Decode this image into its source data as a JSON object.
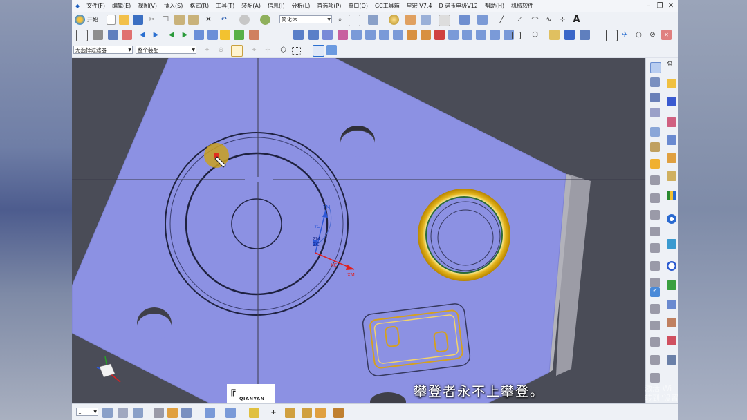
{
  "menu": {
    "items": [
      "文件(F)",
      "编辑(E)",
      "视图(V)",
      "插入(S)",
      "格式(R)",
      "工具(T)",
      "装配(A)",
      "信息(I)",
      "分析(L)",
      "首选项(P)",
      "窗口(O)",
      "GC工具箱",
      "星宏 V7.4",
      "D 诺玉电极V12",
      "帮助(H)",
      "机械软件"
    ]
  },
  "toolbar": {
    "start_label": "开始",
    "shape_dropdown": "简化体",
    "filter_dropdown": "无选择过滤器",
    "scope_dropdown": "整个装配",
    "status_dropdown": "1"
  },
  "overlay": {
    "subtitle": "攀登者永不上攀登。",
    "watermark_line1": "激活 Wi",
    "watermark_line2": "转到\"设置",
    "logo_text": "QIANYAN"
  },
  "csys": {
    "xm": "XM",
    "ym": "YM",
    "zm": "ZM",
    "xc": "XC",
    "yc": "YC",
    "zc": "ZC"
  },
  "colors": {
    "part_face": "#8c91e3",
    "part_side": "#a8a8b0",
    "background": "#4a4c57",
    "highlight": "#e0b020"
  }
}
